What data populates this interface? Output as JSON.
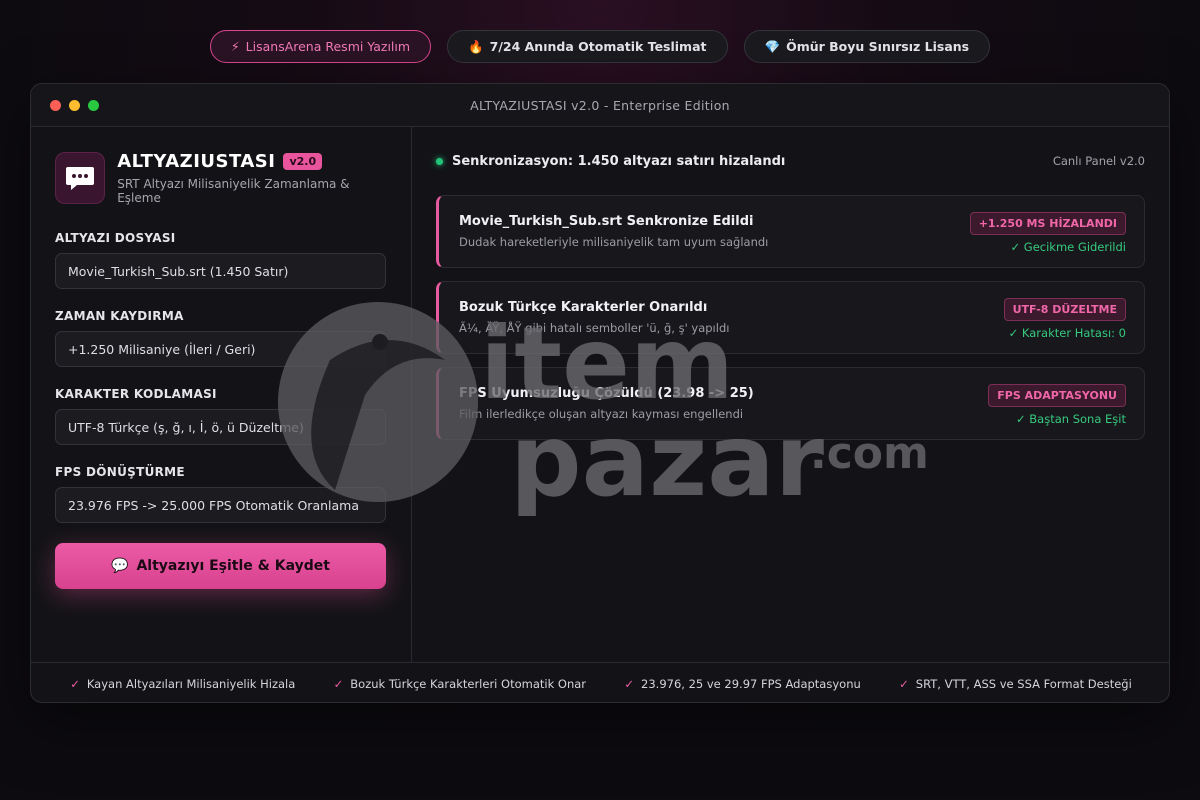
{
  "top_pills": [
    {
      "icon": "⚡",
      "label": "LisansArena Resmi Yazılım"
    },
    {
      "icon": "🔥",
      "label": "7/24 Anında Otomatik Teslimat"
    },
    {
      "icon": "💎",
      "label": "Ömür Boyu Sınırsız Lisans"
    }
  ],
  "window": {
    "title": "ALTYAZIUSTASI v2.0 - Enterprise Edition"
  },
  "brand": {
    "title": "ALTYAZIUSTASI",
    "version": "v2.0",
    "subtitle": "SRT Altyazı Milisaniyelik Zamanlama & Eşleme"
  },
  "fields": [
    {
      "label": "ALTYAZI DOSYASI",
      "value": "Movie_Turkish_Sub.srt (1.450 Satır)"
    },
    {
      "label": "ZAMAN KAYDIRMA",
      "value": "+1.250 Milisaniye (İleri / Geri)"
    },
    {
      "label": "KARAKTER KODLAMASI",
      "value": "UTF-8 Türkçe (ş, ğ, ı, İ, ö, ü Düzeltme)"
    },
    {
      "label": "FPS DÖNÜŞTÜRME",
      "value": "23.976 FPS -> 25.000 FPS Otomatik Oranlama"
    }
  ],
  "cta": {
    "icon": "💬",
    "label": "Altyazıyı Eşitle & Kaydet"
  },
  "status": {
    "text": "Senkronizasyon: 1.450 altyazı satırı hizalandı",
    "panel_label": "Canlı Panel v2.0"
  },
  "cards": [
    {
      "title": "Movie_Turkish_Sub.srt Senkronize Edildi",
      "desc": "Dudak hareketleriyle milisaniyelik tam uyum sağlandı",
      "badge": "+1.250 MS HİZALANDI",
      "ok": "✓ Gecikme Giderildi"
    },
    {
      "title": "Bozuk Türkçe Karakterler Onarıldı",
      "desc": "Ã¼, ÄŸ, ÅŸ gibi hatalı semboller 'ü, ğ, ş' yapıldı",
      "badge": "UTF-8 DÜZELTME",
      "ok": "✓ Karakter Hatası: 0"
    },
    {
      "title": "FPS Uyumsuzluğu Çözüldü (23.98 -> 25)",
      "desc": "Film ilerledikçe oluşan altyazı kayması engellendi",
      "badge": "FPS ADAPTASYONU",
      "ok": "✓ Baştan Sona Eşit"
    }
  ],
  "features": [
    {
      "check": "✓",
      "label": "Kayan Altyazıları Milisaniyelik Hizala"
    },
    {
      "check": "✓",
      "label": "Bozuk Türkçe Karakterleri Otomatik Onar"
    },
    {
      "check": "✓",
      "label": "23.976, 25 ve 29.97 FPS Adaptasyonu"
    },
    {
      "check": "✓",
      "label": "SRT, VTT, ASS ve SSA Format Desteği"
    }
  ],
  "watermark": {
    "line1": "item",
    "line2": "pazar",
    "suffix": ".com"
  },
  "colors": {
    "accent": "#e8559c",
    "success": "#36c97f",
    "bg": "#131317"
  }
}
